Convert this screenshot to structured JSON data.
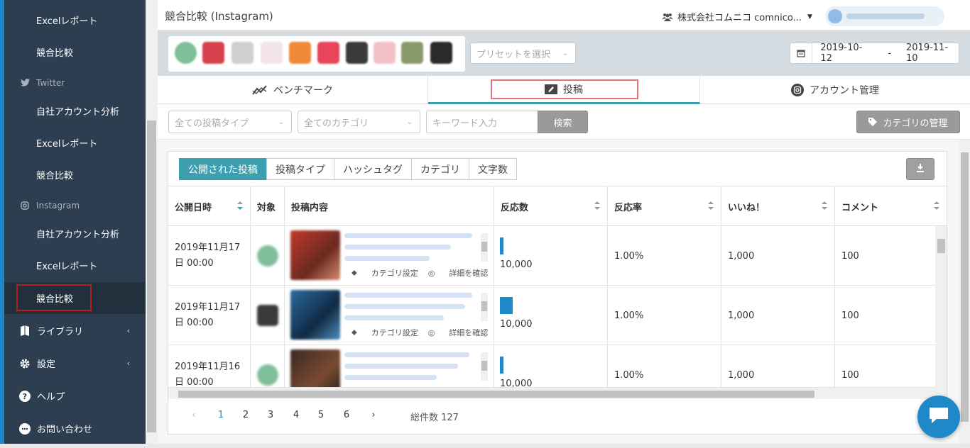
{
  "sidebar": {
    "items_top": [
      {
        "label": "Excelレポート"
      },
      {
        "label": "競合比較"
      }
    ],
    "twitter_header": "Twitter",
    "twitter_items": [
      {
        "label": "自社アカウント分析"
      },
      {
        "label": "Excelレポート"
      },
      {
        "label": "競合比較"
      }
    ],
    "instagram_header": "Instagram",
    "instagram_items": [
      {
        "label": "自社アカウント分析"
      },
      {
        "label": "Excelレポート"
      },
      {
        "label": "競合比較"
      }
    ],
    "main_items": [
      {
        "label": "ライブラリ",
        "icon": "book-icon"
      },
      {
        "label": "設定",
        "icon": "gear-icon"
      },
      {
        "label": "ヘルプ",
        "icon": "help-icon"
      },
      {
        "label": "お問い合わせ",
        "icon": "contact-icon"
      }
    ]
  },
  "header": {
    "title": "競合比較 (Instagram)",
    "company": "株式会社コムニコ comnico..."
  },
  "filters": {
    "preset_placeholder": "プリセットを選択",
    "date_start": "2019-10-12",
    "date_sep": "-",
    "date_end": "2019-11-10",
    "accent": "#3d9eae"
  },
  "tabs": [
    {
      "label": "ベンチマーク"
    },
    {
      "label": "投稿"
    },
    {
      "label": "アカウント管理"
    }
  ],
  "subfilter": {
    "post_type": "全ての投稿タイプ",
    "category": "全てのカテゴリ",
    "keyword_placeholder": "キーワード入力",
    "search": "検索",
    "category_manage": "カテゴリの管理"
  },
  "view_tabs": [
    {
      "label": "公開された投稿"
    },
    {
      "label": "投稿タイプ"
    },
    {
      "label": "ハッシュタグ"
    },
    {
      "label": "カテゴリ"
    },
    {
      "label": "文字数"
    }
  ],
  "table": {
    "columns": [
      "公開日時",
      "対象",
      "投稿内容",
      "反応数",
      "反応率",
      "いいね！",
      "コメント"
    ],
    "action_category": "カテゴリ設定",
    "action_detail": "詳細を確認",
    "rows": [
      {
        "date1": "2019年11月17",
        "date2": "日 00:00",
        "reactions": "10,000",
        "reaction_level": 0.3,
        "rate": "1.00%",
        "likes": "1,000",
        "comments": "100"
      },
      {
        "date1": "2019年11月17",
        "date2": "日 00:00",
        "reactions": "10,000",
        "reaction_level": 1.0,
        "rate": "1.00%",
        "likes": "1,000",
        "comments": "100"
      },
      {
        "date1": "2019年11月16",
        "date2": "日 00:00",
        "reactions": "10,000",
        "reaction_level": 0.3,
        "rate": "1.00%",
        "likes": "1,000",
        "comments": "100"
      }
    ]
  },
  "pager": {
    "prev": "‹",
    "pages": [
      "1",
      "2",
      "3",
      "4",
      "5",
      "6"
    ],
    "current": "1",
    "next": "›",
    "total": "総件数 127"
  }
}
